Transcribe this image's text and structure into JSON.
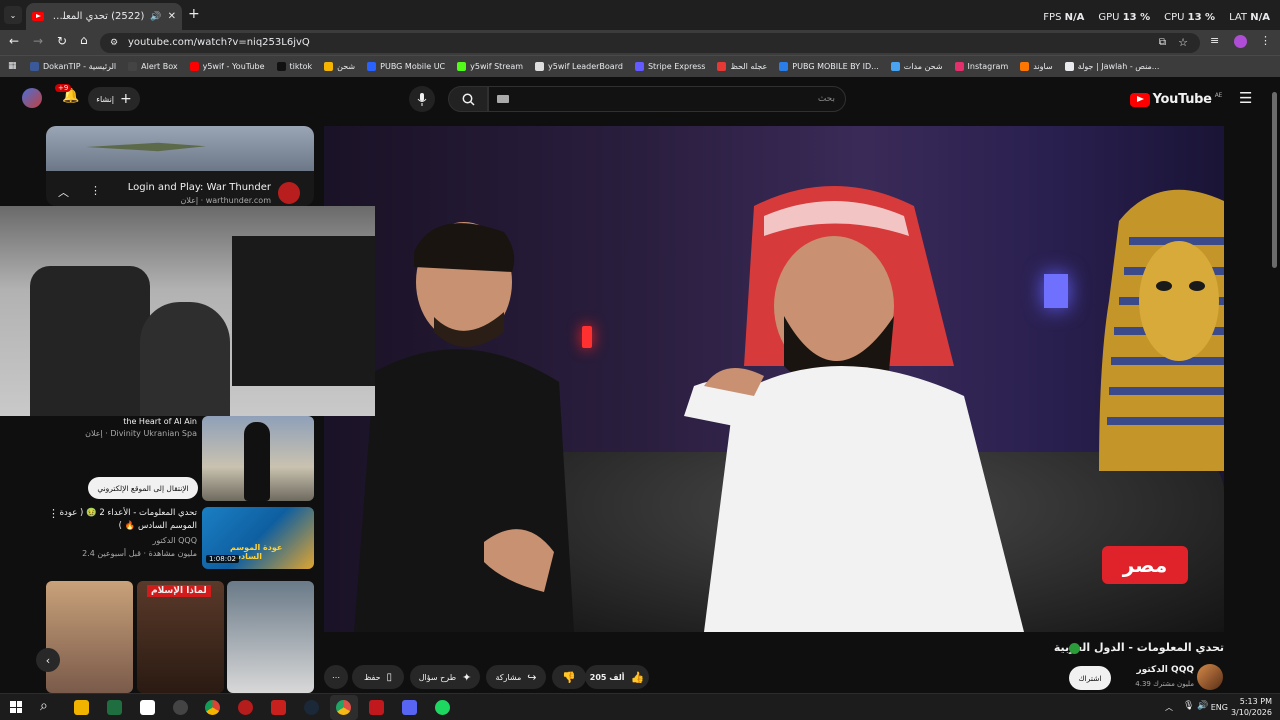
{
  "browser": {
    "tab_title": "(2522) تحدي المعلومات - الد",
    "url": "youtube.com/watch?v=niq253L6jvQ",
    "stats": [
      {
        "label": "FPS",
        "value": "N/A"
      },
      {
        "label": "GPU",
        "value": "13 %"
      },
      {
        "label": "CPU",
        "value": "13 %"
      },
      {
        "label": "LAT",
        "value": "N/A"
      }
    ],
    "bookmarks": [
      {
        "label": "DokanTIP - الرئيسية",
        "color": "#3b5998"
      },
      {
        "label": "Alert Box",
        "color": "#444"
      },
      {
        "label": "y5wif - YouTube",
        "color": "#ff0000"
      },
      {
        "label": "tiktok",
        "color": "#111"
      },
      {
        "label": "شحن",
        "color": "#f4b400"
      },
      {
        "label": "PUBG Mobile UC",
        "color": "#2962ff"
      },
      {
        "label": "y5wif Stream",
        "color": "#53fc18"
      },
      {
        "label": "y5wif LeaderBoard",
        "color": "#ddd"
      },
      {
        "label": "Stripe Express",
        "color": "#635bff"
      },
      {
        "label": "عجله الحظ",
        "color": "#e53935"
      },
      {
        "label": "PUBG MOBILE BY ID...",
        "color": "#2b7de9"
      },
      {
        "label": "شحن مدات",
        "color": "#4aa3f0"
      },
      {
        "label": "Instagram",
        "color": "#e1306c"
      },
      {
        "label": "ساوند",
        "color": "#ff7700"
      },
      {
        "label": "جولة | Jawlah - منص...",
        "color": "#e8eaed"
      }
    ]
  },
  "youtube": {
    "logo_text": "YouTube",
    "region": "AE",
    "search_placeholder": "بحث",
    "create_label": "إنشاء",
    "notif_count": "+9"
  },
  "sidebar": {
    "ad": {
      "title": "Login and Play: War Thunder",
      "sub": "إعلان · warthunder.com"
    },
    "sponsored": {
      "line1": "the Heart of Al Ain",
      "line2": "إعلان · Divinity Ukranian Spa",
      "cta": "الإنتقال إلى الموقع الإلكتروني"
    },
    "next_video": {
      "title": "تحدي المعلومات - الأعداء 2 🤢 ( عودة الموسم السادس 🔥 )",
      "channel": "الدكتور QQQ",
      "meta": "2.4 مليون مشاهدة · قبل أسبوعين",
      "duration": "1:08:02",
      "thumb_caption": "عودة الموسم السادس"
    },
    "shorts_caption": "لماذا الإسلام"
  },
  "video": {
    "title": "تحدي المعلومات - الدول العربية",
    "country_badge": "مصر",
    "channel": "الدكتور QQQ",
    "subscribers": "4.39 مليون مشترك",
    "subscribe_label": "اشتراك",
    "likes": "205 ألف",
    "share_label": "مشاركة",
    "ask_label": "طرح سؤال",
    "save_label": "حفظ"
  },
  "taskbar": {
    "lang": "ENG",
    "time": "5:13 PM",
    "date": "3/10/2026"
  }
}
